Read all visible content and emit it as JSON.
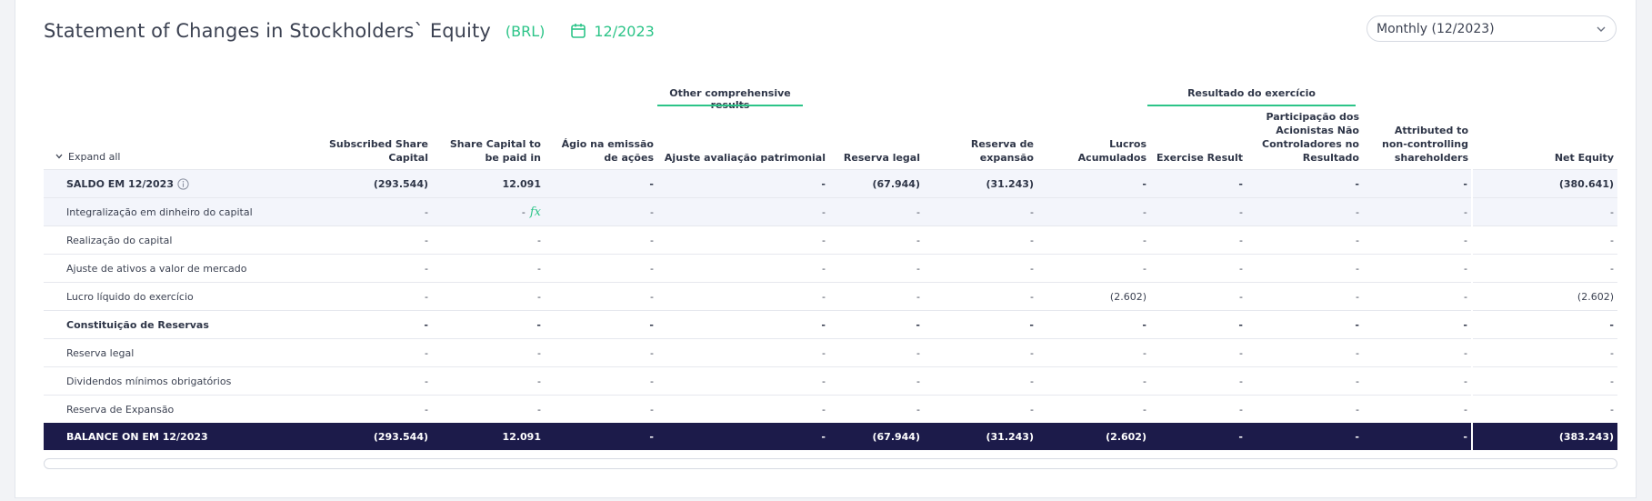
{
  "header": {
    "title": "Statement of Changes in Stockholders` Equity",
    "currency": "(BRL)",
    "date": "12/2023"
  },
  "period_select": {
    "value": "Monthly (12/2023)"
  },
  "groups": {
    "oci": "Other comprehensive results",
    "result": "Resultado do exercício"
  },
  "columns": {
    "expand_all": "Expand all",
    "c1": "Subscribed Share Capital",
    "c2": "Share Capital to be paid in",
    "c3": "Ágio na emissão de ações",
    "c4": "Ajuste avaliação patrimonial",
    "c5": "Reserva legal",
    "c6": "Reserva de expansão",
    "c7": "Lucros Acumulados",
    "c8": "Exercise Result",
    "c9": "Participação dos Acionistas Não Controladores no Resultado",
    "c10": "Attributed to non-controlling shareholders",
    "c11": "Net Equity"
  },
  "rows": [
    {
      "label": "SALDO EM 12/2023",
      "values": [
        "(293.544)",
        "12.091",
        "-",
        "-",
        "(67.944)",
        "(31.243)",
        "-",
        "-",
        "-",
        "-",
        "(380.641)"
      ]
    },
    {
      "label": "Integralização em dinheiro do capital",
      "values": [
        "-",
        "-",
        "-",
        "-",
        "-",
        "-",
        "-",
        "-",
        "-",
        "-",
        "-"
      ],
      "fx": "fx"
    },
    {
      "label": "Realização do capital",
      "values": [
        "-",
        "-",
        "-",
        "-",
        "-",
        "-",
        "-",
        "-",
        "-",
        "-",
        "-"
      ]
    },
    {
      "label": "Ajuste de ativos a valor de mercado",
      "values": [
        "-",
        "-",
        "-",
        "-",
        "-",
        "-",
        "-",
        "-",
        "-",
        "-",
        "-"
      ]
    },
    {
      "label": "Lucro líquido do exercício",
      "values": [
        "-",
        "-",
        "-",
        "-",
        "-",
        "-",
        "(2.602)",
        "-",
        "-",
        "-",
        "(2.602)"
      ]
    },
    {
      "label": "Constituição de Reservas",
      "values": [
        "-",
        "-",
        "-",
        "-",
        "-",
        "-",
        "-",
        "-",
        "-",
        "-",
        "-"
      ]
    },
    {
      "label": "Reserva legal",
      "values": [
        "-",
        "-",
        "-",
        "-",
        "-",
        "-",
        "-",
        "-",
        "-",
        "-",
        "-"
      ]
    },
    {
      "label": "Dividendos mínimos obrigatórios",
      "values": [
        "-",
        "-",
        "-",
        "-",
        "-",
        "-",
        "-",
        "-",
        "-",
        "-",
        "-"
      ]
    },
    {
      "label": "Reserva de Expansão",
      "values": [
        "-",
        "-",
        "-",
        "-",
        "-",
        "-",
        "-",
        "-",
        "-",
        "-",
        "-"
      ]
    },
    {
      "label": "BALANCE ON EM 12/2023",
      "values": [
        "(293.544)",
        "12.091",
        "-",
        "-",
        "(67.944)",
        "(31.243)",
        "(2.602)",
        "-",
        "-",
        "-",
        "(383.243)"
      ]
    }
  ]
}
